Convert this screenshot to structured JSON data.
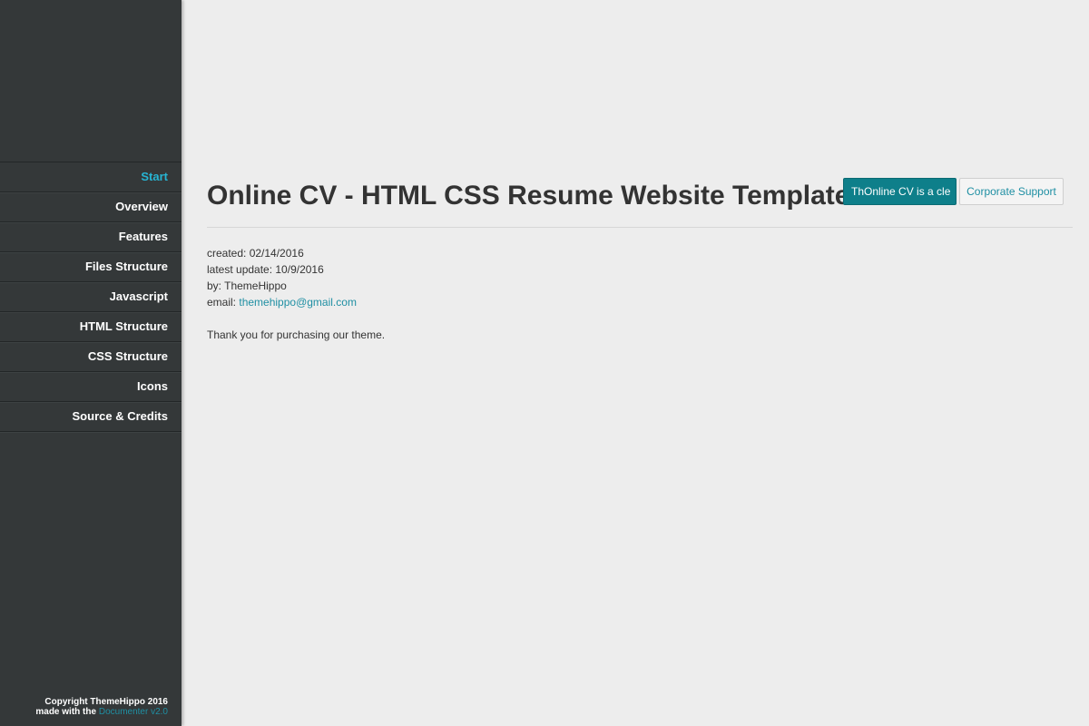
{
  "sidebar": {
    "items": [
      {
        "label": "Start",
        "active": true
      },
      {
        "label": "Overview"
      },
      {
        "label": "Features"
      },
      {
        "label": "Files Structure"
      },
      {
        "label": "Javascript"
      },
      {
        "label": "HTML Structure"
      },
      {
        "label": "CSS Structure"
      },
      {
        "label": "Icons"
      },
      {
        "label": "Source & Credits"
      }
    ],
    "footer": {
      "copyright": "Copyright ThemeHippo 2016",
      "made_with": "made with the",
      "doc_link": "Documenter v2.0"
    }
  },
  "main": {
    "title": "Online CV - HTML CSS Resume Website Template",
    "primary_button": "ThOnline CV is a cle",
    "secondary_button": "Corporate Support",
    "meta": {
      "created": "created: 02/14/2016",
      "updated": "latest update: 10/9/2016",
      "by": "by: ThemeHippo",
      "email_label": "email:",
      "email": "themehippo@gmail.com"
    },
    "thanks": "Thank you for purchasing our theme."
  },
  "colors": {
    "sidebar_bg": "#343839",
    "active": "#27b5d3",
    "accent": "#0e7f8a",
    "link": "#1f8fa3",
    "page_bg": "#ededed"
  }
}
